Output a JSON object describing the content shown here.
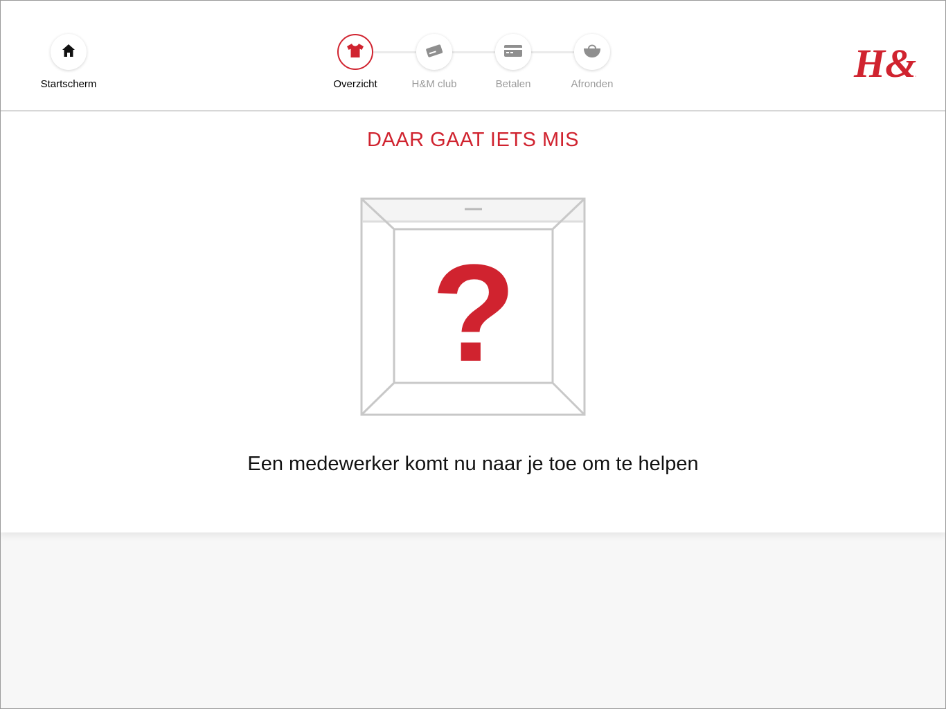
{
  "nav": {
    "home_label": "Startscherm",
    "steps": [
      {
        "label": "Overzicht",
        "icon": "tshirt-icon",
        "state": "active"
      },
      {
        "label": "H&M club",
        "icon": "member-card-icon",
        "state": "inactive"
      },
      {
        "label": "Betalen",
        "icon": "credit-card-icon",
        "state": "inactive"
      },
      {
        "label": "Afronden",
        "icon": "bag-icon",
        "state": "inactive"
      }
    ]
  },
  "brand": {
    "logo_text": "H&M",
    "accent_color": "#d0232f"
  },
  "error": {
    "title": "DAAR GAAT IETS MIS",
    "symbol": "?",
    "message": "Een medewerker komt nu naar je toe om te helpen"
  }
}
